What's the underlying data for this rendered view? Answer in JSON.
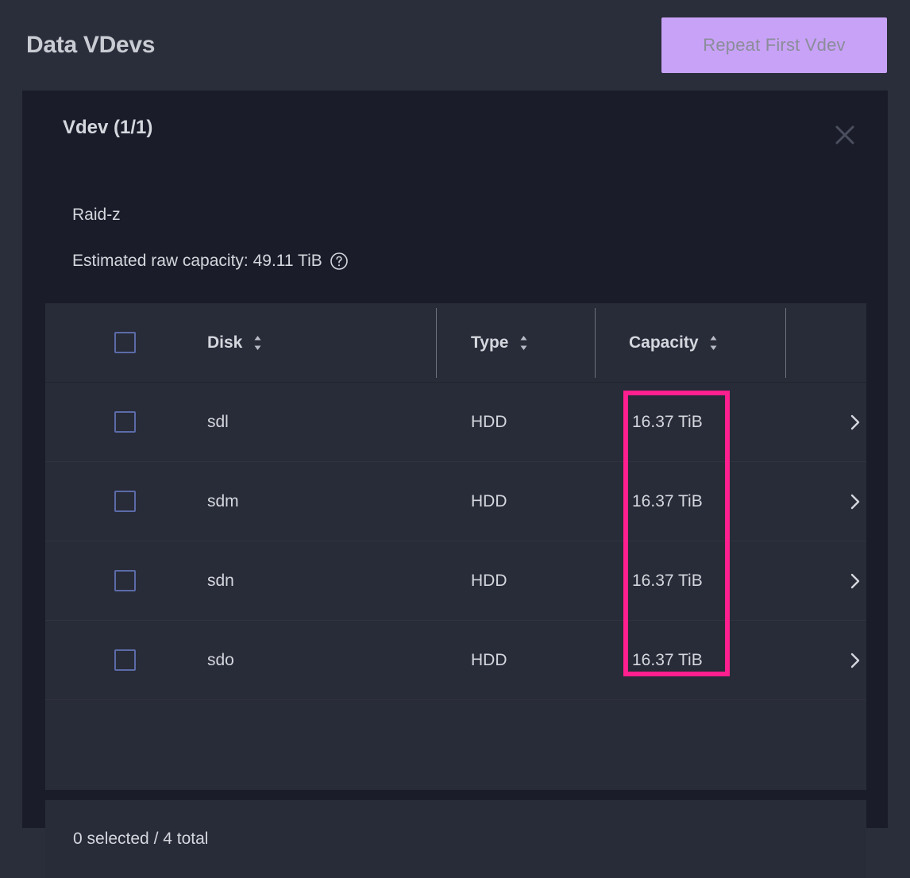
{
  "header": {
    "title": "Data VDevs",
    "repeat_button_label": "Repeat First Vdev"
  },
  "card": {
    "title": "Vdev (1/1)",
    "close_icon": "close-icon",
    "raid_type": "Raid-z",
    "estimated_capacity_label": "Estimated raw capacity: 49.11 TiB",
    "help_icon": "help-circle-icon"
  },
  "table": {
    "columns": [
      {
        "key": "select",
        "label": "",
        "sortable": false
      },
      {
        "key": "disk",
        "label": "Disk",
        "sortable": true
      },
      {
        "key": "type",
        "label": "Type",
        "sortable": true
      },
      {
        "key": "capacity",
        "label": "Capacity",
        "sortable": true
      },
      {
        "key": "expand",
        "label": "",
        "sortable": false
      }
    ],
    "rows": [
      {
        "disk": "sdl",
        "type": "HDD",
        "capacity": "16.37 TiB",
        "selected": false,
        "expand_icon": "chevron-right-icon"
      },
      {
        "disk": "sdm",
        "type": "HDD",
        "capacity": "16.37 TiB",
        "selected": false,
        "expand_icon": "chevron-right-icon"
      },
      {
        "disk": "sdn",
        "type": "HDD",
        "capacity": "16.37 TiB",
        "selected": false,
        "expand_icon": "chevron-right-icon"
      },
      {
        "disk": "sdo",
        "type": "HDD",
        "capacity": "16.37 TiB",
        "selected": false,
        "expand_icon": "chevron-right-icon"
      }
    ],
    "footer_status": "0 selected / 4 total",
    "sort_icon": "sort-updown-icon"
  },
  "annotation": {
    "name": "capacity-column-highlight",
    "color": "#ff1f8e"
  },
  "colors": {
    "page_background": "#2a2d3a",
    "card_background": "#1a1d29",
    "table_background": "#282b38",
    "accent_button": "#c8a2f7",
    "text_primary": "#d4d7dd",
    "checkbox_border": "#5b6ba8",
    "annotation": "#ff1f8e"
  }
}
